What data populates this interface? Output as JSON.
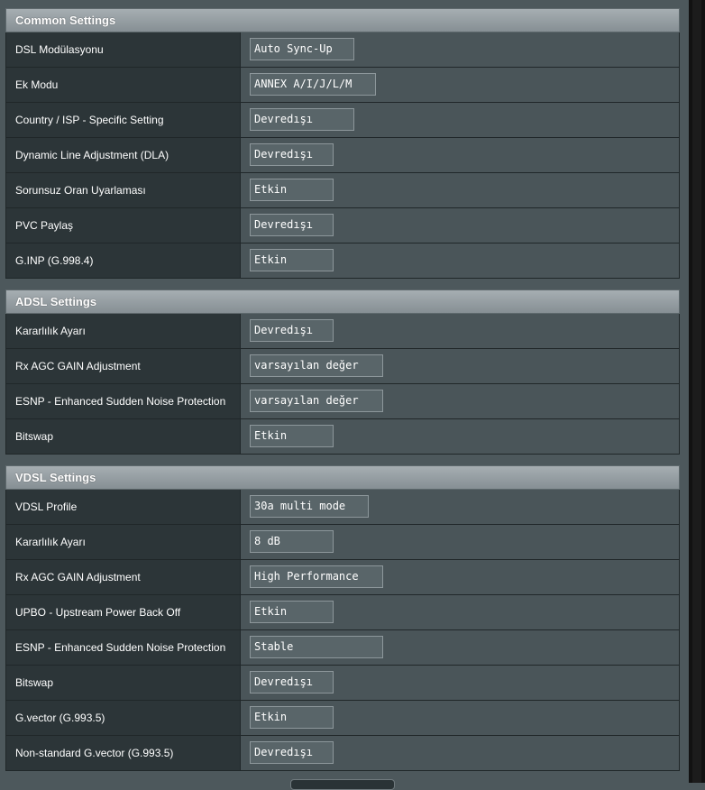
{
  "common": {
    "title": "Common Settings",
    "rows": [
      {
        "label": "DSL Modülasyonu",
        "value": "Auto Sync-Up"
      },
      {
        "label": "Ek Modu",
        "value": "ANNEX A/I/J/L/M"
      },
      {
        "label": "Country / ISP - Specific Setting",
        "value": "Devredışı"
      },
      {
        "label": "Dynamic Line Adjustment (DLA)",
        "value": "Devredışı"
      },
      {
        "label": "Sorunsuz Oran Uyarlaması",
        "value": "Etkin"
      },
      {
        "label": "PVC Paylaş",
        "value": "Devredışı"
      },
      {
        "label": "G.INP (G.998.4)",
        "value": "Etkin"
      }
    ]
  },
  "adsl": {
    "title": "ADSL Settings",
    "rows": [
      {
        "label": "Kararlılık Ayarı",
        "value": "Devredışı"
      },
      {
        "label": "Rx AGC GAIN Adjustment",
        "value": "varsayılan değer"
      },
      {
        "label": "ESNP - Enhanced Sudden Noise Protection",
        "value": "varsayılan değer"
      },
      {
        "label": "Bitswap",
        "value": "Etkin"
      }
    ]
  },
  "vdsl": {
    "title": "VDSL Settings",
    "rows": [
      {
        "label": "VDSL Profile",
        "value": "30a multi mode"
      },
      {
        "label": "Kararlılık Ayarı",
        "value": "8 dB"
      },
      {
        "label": "Rx AGC GAIN Adjustment",
        "value": "High Performance"
      },
      {
        "label": "UPBO - Upstream Power Back Off",
        "value": "Etkin"
      },
      {
        "label": "ESNP - Enhanced Sudden Noise Protection",
        "value": "Stable"
      },
      {
        "label": "Bitswap",
        "value": "Devredışı"
      },
      {
        "label": "G.vector (G.993.5)",
        "value": "Etkin"
      },
      {
        "label": "Non-standard G.vector (G.993.5)",
        "value": "Devredışı"
      }
    ]
  }
}
